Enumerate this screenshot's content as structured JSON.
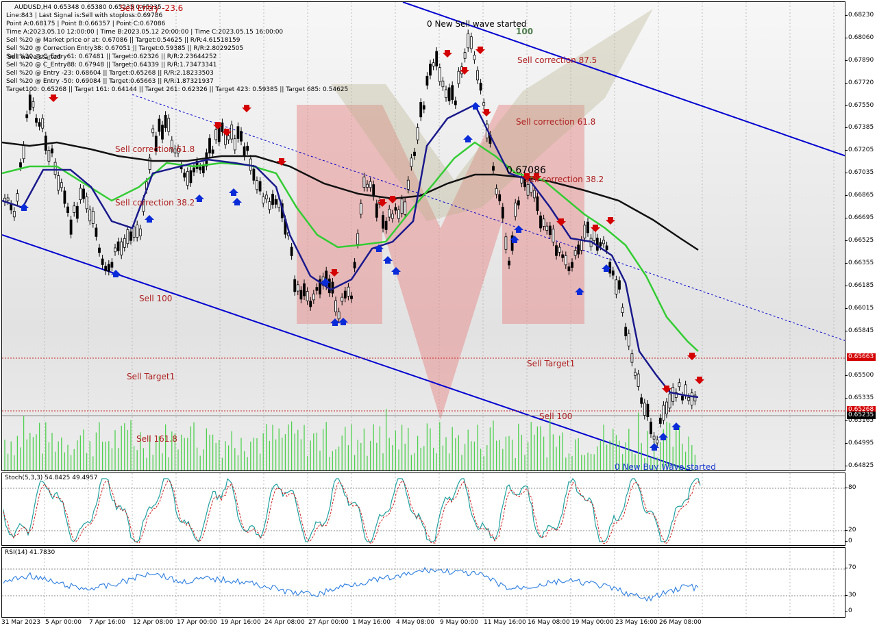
{
  "header": {
    "symbol": "AUDUSD,H4  0.65348 0.65380 0.65235 0.65235",
    "lines": [
      "Line:843 | Last Signal is:Sell with stoploss:0.69786",
      "Point A:0.68175 | Point B:0.66357 | Point C:0.67086",
      "Time A:2023.05.10 12:00:00 | Time B:2023.05.12 20:00:00 | Time C:2023.05.15 16:00:00",
      "Sell %20 @ Market price or at: 0.67086 || Target:0.54625 || R/R:4.61518159",
      "Sell %20 @ Correction Entry38: 0.67051 || Target:0.59385 || R/R:2.80292505",
      "Sell %20 @ C_Entry61: 0.67481 || Target:0.62326 || R/R:2.23644252",
      "Sell %20 @ C_Entry88: 0.67948 || Target:0.64339 || R/R:1.73473341",
      "Sell %20 @ Entry -23: 0.68604 || Target:0.65268 || R/R:2.18233503",
      "Sell %20 @ Entry -50: 0.69084 || Target:0.65663 || R/R:1.87321937",
      "Target100: 0.65268 || Target 161: 0.64144 || Target 261: 0.62326 || Target 423: 0.59385 || Target 685: 0.54625"
    ]
  },
  "overlay": {
    "sell_entry": "Sell Entry -23.6",
    "sell_wave": "Sell wave started",
    "new_sell_wave": "0 New Sell wave started",
    "new_buy_wave": "0 New Buy Wave started",
    "point_c": "0.67086",
    "label_100": "100",
    "sell_correction_875": "Sell correction 87.5",
    "sell_correction_618_right": "Sell correction 61.8",
    "sell_correction_382_right": "Sell correction 38.2",
    "sell_correction_618_left": "Sell correction 61.8",
    "sell_correction_382_left": "Sell correction 38.2",
    "sell_100_left": "Sell 100",
    "sell_target1_left": "Sell Target1",
    "sell_1618": "Sell 161.8",
    "sell_target1_right": "Sell Target1",
    "sell_100_right": "Sell 100"
  },
  "price_axis": [
    "0.68230",
    "0.68060",
    "0.67890",
    "0.67720",
    "0.67550",
    "0.67385",
    "0.67205",
    "0.67035",
    "0.66865",
    "0.66695",
    "0.66525",
    "0.66355",
    "0.66185",
    "0.66015",
    "0.65845",
    "0.65500",
    "0.65335",
    "0.65165",
    "0.64995",
    "0.64825"
  ],
  "price_tags": {
    "target1": "0.65663",
    "target100": "0.65268",
    "current": "0.65235"
  },
  "colors": {
    "sell_red": "#d40000",
    "buy_blue": "#0a2bd8",
    "channel_blue": "#0000d0",
    "ma_fast": "#1a1a8c",
    "ma_mid": "#33cc33",
    "ma_slow": "#111111"
  },
  "stoch": {
    "label": "Stoch(5,3,3) 54.8425 49.4957",
    "levels": [
      "80",
      "20",
      "0"
    ]
  },
  "rsi": {
    "label": "RSI(14) 41.7830",
    "levels": [
      "70",
      "30",
      "0"
    ]
  },
  "time_axis": [
    "31 Mar 2023",
    "5 Apr 00:00",
    "7 Apr 16:00",
    "12 Apr 08:00",
    "17 Apr 00:00",
    "19 Apr 16:00",
    "24 Apr 08:00",
    "27 Apr 00:00",
    "1 May 16:00",
    "4 May 08:00",
    "9 May 00:00",
    "11 May 16:00",
    "16 May 08:00",
    "19 May 00:00",
    "23 May 16:00",
    "26 May 08:00"
  ]
}
